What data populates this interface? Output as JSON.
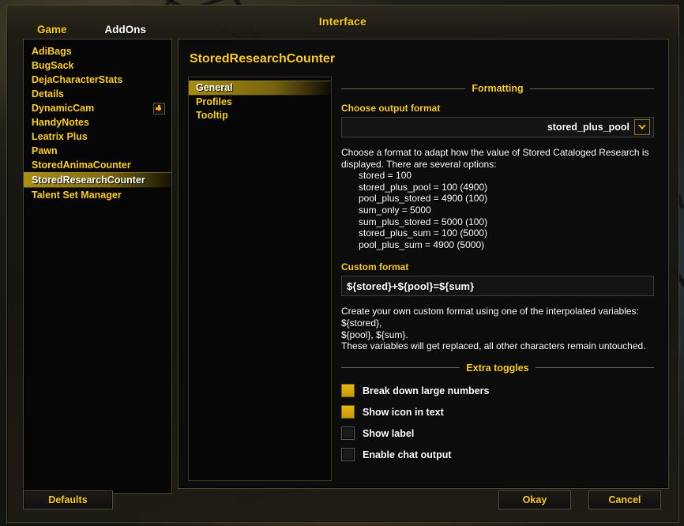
{
  "window": {
    "title": "Interface"
  },
  "tabs": [
    {
      "label": "Game",
      "active": false
    },
    {
      "label": "AddOns",
      "active": true
    }
  ],
  "addon_list": [
    {
      "label": "AdiBags",
      "selected": false,
      "expandable": false
    },
    {
      "label": "BugSack",
      "selected": false,
      "expandable": false
    },
    {
      "label": "DejaCharacterStats",
      "selected": false,
      "expandable": false
    },
    {
      "label": "Details",
      "selected": false,
      "expandable": false
    },
    {
      "label": "DynamicCam",
      "selected": false,
      "expandable": true
    },
    {
      "label": "HandyNotes",
      "selected": false,
      "expandable": false
    },
    {
      "label": "Leatrix Plus",
      "selected": false,
      "expandable": false
    },
    {
      "label": "Pawn",
      "selected": false,
      "expandable": false
    },
    {
      "label": "StoredAnimaCounter",
      "selected": false,
      "expandable": false
    },
    {
      "label": "StoredResearchCounter",
      "selected": true,
      "expandable": false
    },
    {
      "label": "Talent Set Manager",
      "selected": false,
      "expandable": false
    }
  ],
  "panel": {
    "title": "StoredResearchCounter"
  },
  "subnav": [
    {
      "label": "General",
      "selected": true
    },
    {
      "label": "Profiles",
      "selected": false
    },
    {
      "label": "Tooltip",
      "selected": false
    }
  ],
  "formatting": {
    "section_label": "Formatting",
    "choose_output_label": "Choose output format",
    "dropdown_value": "stored_plus_pool",
    "dropdown_icon": "chevron-down-icon",
    "description_intro": "Choose a format to adapt how the value of Stored Cataloged Research is\ndisplayed. There are several options:",
    "format_options": "stored = 100\nstored_plus_pool = 100 (4900)\npool_plus_stored = 4900 (100)\nsum_only = 5000\nsum_plus_stored = 5000 (100)\nstored_plus_sum = 100 (5000)\npool_plus_sum = 4900 (5000)",
    "custom_format_label": "Custom format",
    "custom_format_value": "${stored}+${pool}=${sum}",
    "custom_format_placeholder": "${stored}+${pool}=${sum}",
    "custom_format_description": "Create your own custom format using one of the interpolated variables: ${stored},\n${pool}, ${sum}.\nThese variables will get replaced, all other characters remain untouched."
  },
  "extra_toggles": {
    "section_label": "Extra toggles",
    "items": [
      {
        "label": "Break down large numbers",
        "checked": true
      },
      {
        "label": "Show icon in text",
        "checked": true
      },
      {
        "label": "Show label",
        "checked": false
      },
      {
        "label": "Enable chat output",
        "checked": false
      }
    ]
  },
  "buttons": {
    "defaults": "Defaults",
    "okay": "Okay",
    "cancel": "Cancel"
  },
  "colors": {
    "gold": "#ffd100",
    "white": "#ffffff",
    "checkbox_checked": "#e8b80c",
    "panel_bg": "#0c0c0c",
    "frame_border": "#4a4632"
  }
}
